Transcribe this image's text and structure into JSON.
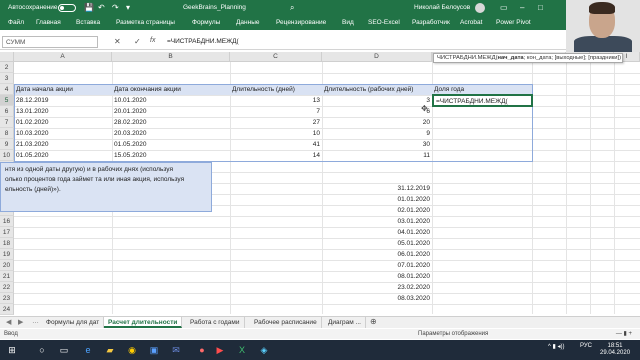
{
  "titlebar": {
    "autosave_label": "Автосохранение",
    "doc_title": "GeekBrains_Planning",
    "user_name": "Николай Белоусов",
    "accent": "#217346"
  },
  "ribbon": {
    "tabs": [
      "Файл",
      "Главная",
      "Вставка",
      "Разметка страницы",
      "Формулы",
      "Данные",
      "Рецензирование",
      "Вид",
      "SEO-Excel",
      "Разработчик",
      "Acrobat",
      "Power Pivot"
    ]
  },
  "formula_bar": {
    "name_box": "СУММ",
    "fx": "fx",
    "formula": "=ЧИСТРАБДНИ.МЕЖД("
  },
  "columns": [
    "A",
    "B",
    "C",
    "D",
    "E",
    "F",
    "G",
    "H",
    "I"
  ],
  "rows": [
    "2",
    "3",
    "4",
    "5",
    "6",
    "7",
    "8",
    "9",
    "10",
    "11",
    "12",
    "13",
    "14",
    "15",
    "16",
    "17",
    "18",
    "19",
    "20",
    "21",
    "22",
    "23",
    "24"
  ],
  "table": {
    "headers": [
      "Дата начала акции",
      "Дата окончания акции",
      "Длительность (дней)",
      "Длительность (рабочих дней)",
      "Доля года"
    ],
    "rows": [
      [
        "28.12.2019",
        "10.01.2020",
        "13",
        "3"
      ],
      [
        "13.01.2020",
        "20.01.2020",
        "7",
        "6"
      ],
      [
        "01.02.2020",
        "28.02.2020",
        "27",
        "20"
      ],
      [
        "10.03.2020",
        "20.03.2020",
        "10",
        "9"
      ],
      [
        "21.03.2020",
        "01.05.2020",
        "41",
        "30"
      ],
      [
        "01.05.2020",
        "15.05.2020",
        "14",
        "11"
      ]
    ],
    "editing_cell": "=ЧИСТРАБДНИ.МЕЖД("
  },
  "tooltip": {
    "fn": "ЧИСТРАБДНИ.МЕЖД(",
    "arg_current": "нач_дата",
    "args_rest": "; кон_дата; [выходные]; [праздники])"
  },
  "note_lines": [
    "нтя из одной даты другую) и в рабочих днях (используя",
    "олько процентов года займет та или иная акция, используя",
    "ельность (дней)»)."
  ],
  "dates_list": [
    "31.12.2019",
    "01.01.2020",
    "02.01.2020",
    "03.01.2020",
    "04.01.2020",
    "05.01.2020",
    "06.01.2020",
    "07.01.2020",
    "08.01.2020",
    "23.02.2020",
    "08.03.2020"
  ],
  "sheets": [
    "Формулы для дат",
    "Расчет длительности",
    "Работа с годами",
    "Рабочее расписание",
    "Диаграм ..."
  ],
  "active_sheet": "Расчет длительности",
  "status": {
    "mode": "Ввод",
    "display_settings": "Параметры отображения"
  },
  "taskbar": {
    "lang": "РУС",
    "time": "18:51",
    "date": "29.04.2020"
  }
}
